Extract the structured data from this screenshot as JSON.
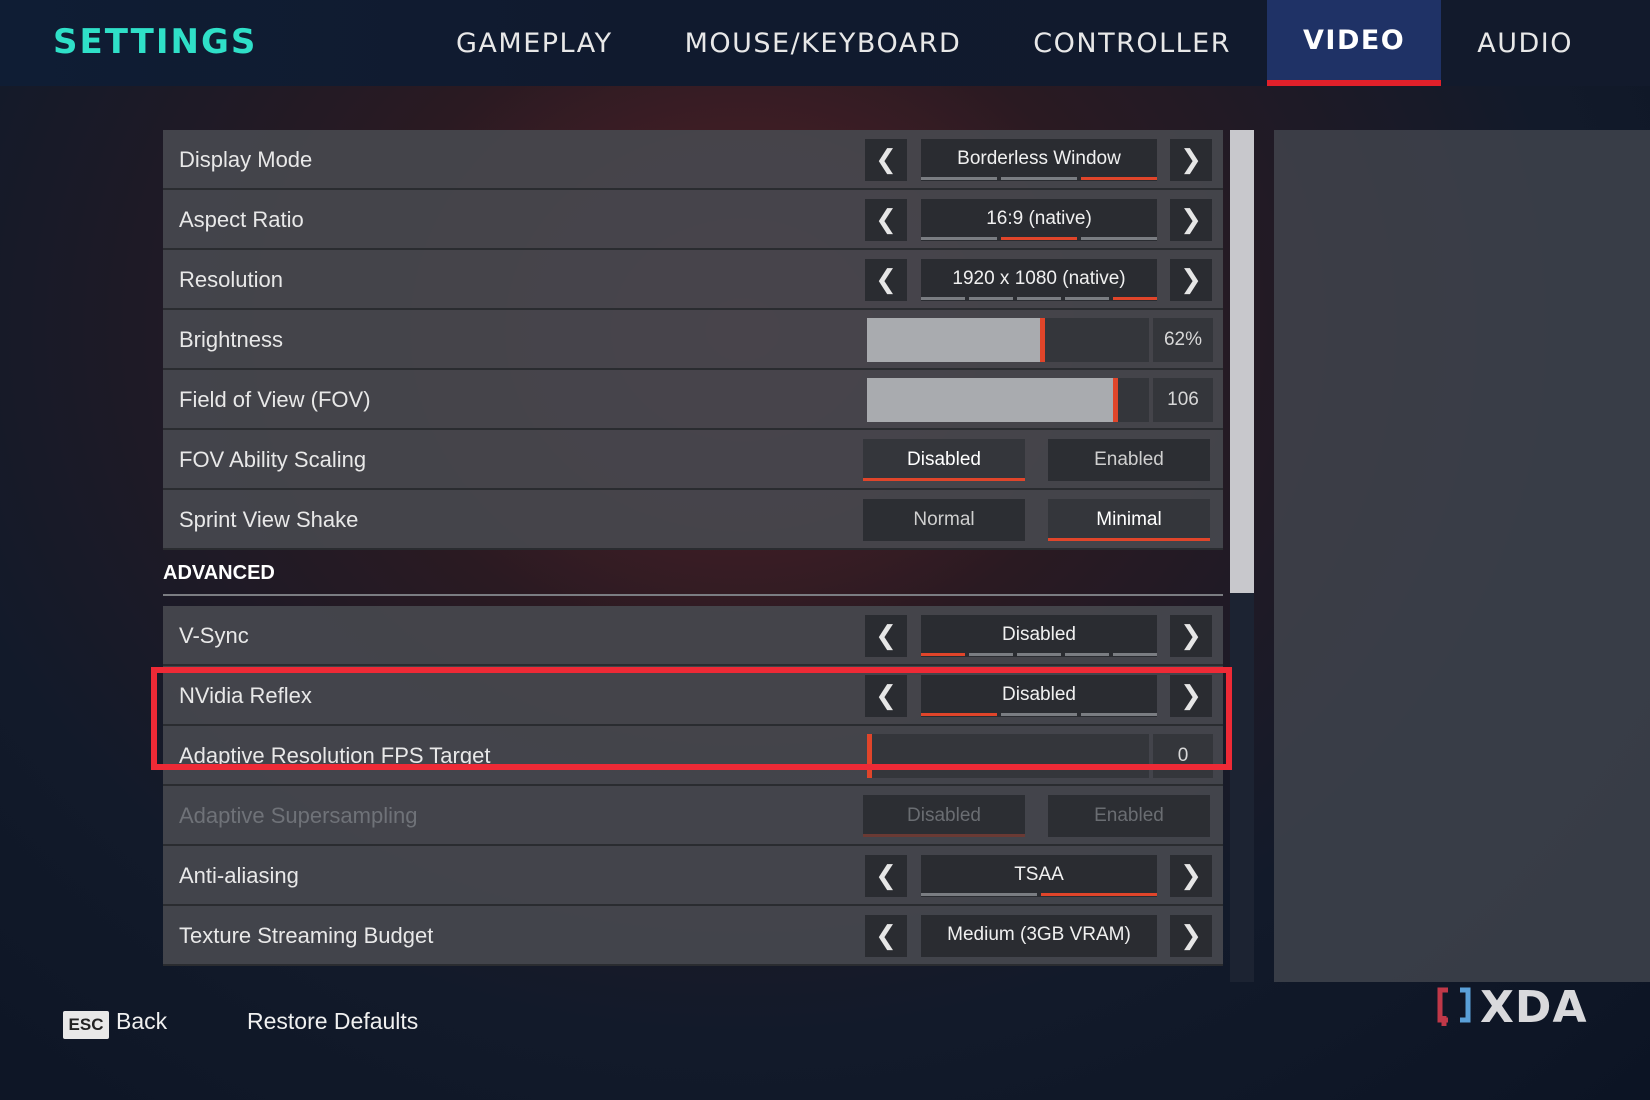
{
  "header": {
    "title": "SETTINGS",
    "tabs": [
      {
        "label": "GAMEPLAY",
        "active": false
      },
      {
        "label": "MOUSE/KEYBOARD",
        "active": false
      },
      {
        "label": "CONTROLLER",
        "active": false
      },
      {
        "label": "VIDEO",
        "active": true
      },
      {
        "label": "AUDIO",
        "active": false
      }
    ]
  },
  "settings": {
    "display_mode": {
      "label": "Display Mode",
      "value": "Borderless Window",
      "options_count": 3,
      "selected_index": 2
    },
    "aspect_ratio": {
      "label": "Aspect Ratio",
      "value": "16:9 (native)",
      "options_count": 3,
      "selected_index": 1
    },
    "resolution": {
      "label": "Resolution",
      "value": "1920 x 1080 (native)",
      "options_count": 5,
      "selected_index": 4
    },
    "brightness": {
      "label": "Brightness",
      "value_text": "62%",
      "level": 0.62
    },
    "fov": {
      "label": "Field of View (FOV)",
      "value_text": "106",
      "level": 0.88
    },
    "fov_ability_scaling": {
      "label": "FOV Ability Scaling",
      "options": [
        "Disabled",
        "Enabled"
      ],
      "selected": "Disabled"
    },
    "sprint_view_shake": {
      "label": "Sprint View Shake",
      "options": [
        "Normal",
        "Minimal"
      ],
      "selected": "Minimal"
    }
  },
  "advanced": {
    "heading": "ADVANCED",
    "vsync": {
      "label": "V-Sync",
      "value": "Disabled",
      "options_count": 5,
      "selected_index": 0
    },
    "nvidia_reflex": {
      "label": "NVidia Reflex",
      "value": "Disabled",
      "options_count": 3,
      "selected_index": 0
    },
    "adaptive_resolution": {
      "label": "Adaptive Resolution FPS Target",
      "value_text": "0",
      "level": 0.0
    },
    "adaptive_supersampling": {
      "label": "Adaptive Supersampling",
      "options": [
        "Disabled",
        "Enabled"
      ],
      "selected": "Disabled",
      "disabled": true
    },
    "anti_aliasing": {
      "label": "Anti-aliasing",
      "value": "TSAA",
      "options_count": 2,
      "selected_index": 1
    },
    "texture_streaming": {
      "label": "Texture Streaming Budget",
      "value": "Medium (3GB VRAM)"
    }
  },
  "footer": {
    "esc_key": "ESC",
    "back_label": "Back",
    "restore_label": "Restore Defaults"
  },
  "watermark": {
    "text": "XDA"
  },
  "colors": {
    "accent": "#e0452a",
    "highlight": "#ee2a36",
    "title": "#2fe0c8",
    "active_tab": "#1f3266"
  }
}
